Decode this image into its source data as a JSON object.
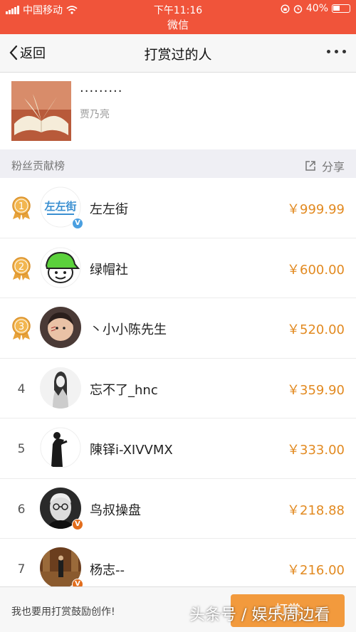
{
  "status_bar": {
    "carrier": "中国移动",
    "time": "下午11:16",
    "battery": "40%"
  },
  "app_title": "微信",
  "navbar": {
    "back_label": "返回",
    "title": "打赏过的人"
  },
  "article": {
    "title": "·········",
    "author": "贾乃亮"
  },
  "section": {
    "title": "粉丝贡献榜",
    "share_label": "分享"
  },
  "rankings": [
    {
      "rank": "1",
      "name": "左左街",
      "amount": "￥999.99",
      "verified": "blue"
    },
    {
      "rank": "2",
      "name": "绿帽社",
      "amount": "￥600.00"
    },
    {
      "rank": "3",
      "name": "丶小小陈先生",
      "amount": "￥520.00"
    },
    {
      "rank": "4",
      "name": "忘不了_hnc",
      "amount": "￥359.90"
    },
    {
      "rank": "5",
      "name": "陳铎i-XIVVMX",
      "amount": "￥333.00"
    },
    {
      "rank": "6",
      "name": "鸟叔操盘",
      "amount": "￥218.88",
      "verified": "orange"
    },
    {
      "rank": "7",
      "name": "杨志--",
      "amount": "￥216.00",
      "verified": "orange"
    }
  ],
  "bottom": {
    "prompt": "我也要用打赏鼓励创作!",
    "button_label": "打赏"
  },
  "watermark": "头条号 / 娱乐周边看",
  "logo_text": "左左街",
  "colors": {
    "header": "#f0543a",
    "amount": "#e28a21",
    "button": "#f29a3d",
    "medal": "#e7a23a"
  }
}
